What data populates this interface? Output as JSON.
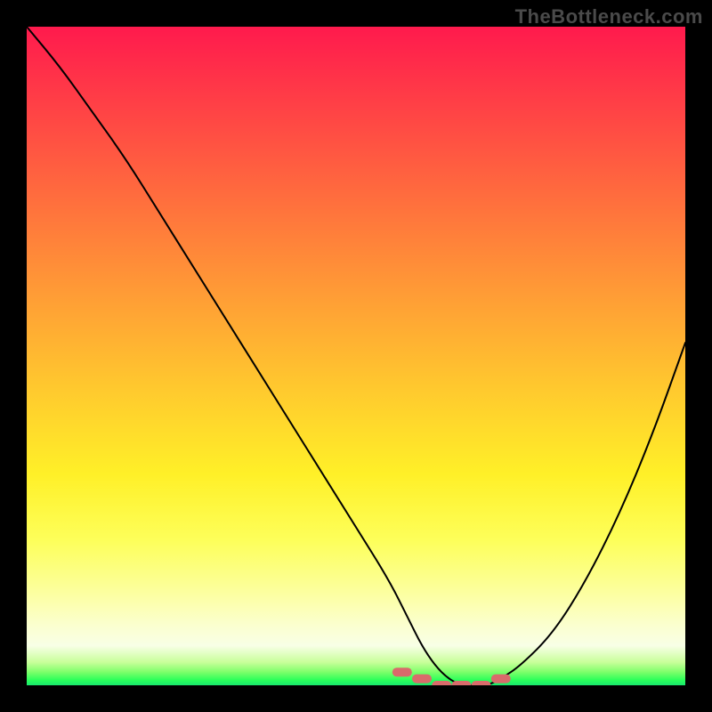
{
  "watermark": "TheBottleneck.com",
  "chart_data": {
    "type": "line",
    "title": "",
    "xlabel": "",
    "ylabel": "",
    "xlim": [
      0,
      100
    ],
    "ylim": [
      0,
      100
    ],
    "series": [
      {
        "name": "bottleneck-curve",
        "x": [
          0,
          5,
          10,
          15,
          20,
          25,
          30,
          35,
          40,
          45,
          50,
          55,
          58,
          60,
          62,
          64,
          66,
          68,
          70,
          72,
          75,
          80,
          85,
          90,
          95,
          100
        ],
        "y": [
          100,
          94,
          87,
          80,
          72,
          64,
          56,
          48,
          40,
          32,
          24,
          16,
          10,
          6,
          3,
          1,
          0,
          0,
          0,
          1,
          3,
          8,
          16,
          26,
          38,
          52
        ]
      }
    ],
    "valley_markers": {
      "x": [
        57,
        60,
        63,
        66,
        69,
        72
      ],
      "y": [
        2,
        1,
        0,
        0,
        0,
        1
      ],
      "color": "#d96b6b"
    },
    "gradient_stops": [
      {
        "pos": 0,
        "color": "#ff1a4d"
      },
      {
        "pos": 55,
        "color": "#ffc92e"
      },
      {
        "pos": 78,
        "color": "#fdff5a"
      },
      {
        "pos": 98,
        "color": "#7dff6a"
      },
      {
        "pos": 100,
        "color": "#18e86e"
      }
    ]
  }
}
